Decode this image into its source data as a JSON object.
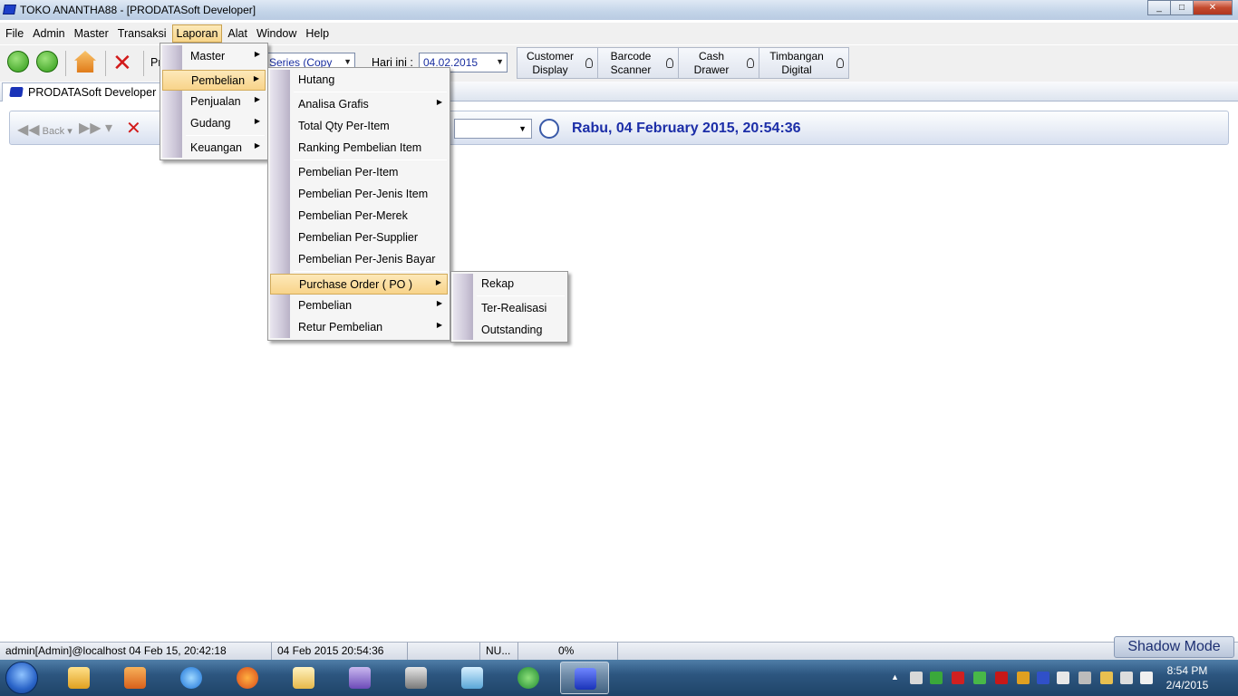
{
  "window": {
    "title": "TOKO ANANTHA88 - [PRODATASoft Developer]",
    "min": "_",
    "max": "□",
    "close": "✕"
  },
  "menubar": [
    "File",
    "Admin",
    "Master",
    "Transaksi",
    "Laporan",
    "Alat",
    "Window",
    "Help"
  ],
  "toolbar": {
    "partial_label": "Pr",
    "series_combo": "Series (Copy",
    "hari_ini_label": "Hari ini :",
    "date_value": "04.02.2015",
    "devices": [
      {
        "line1": "Customer",
        "line2": "Display"
      },
      {
        "line1": "Barcode",
        "line2": "Scanner"
      },
      {
        "line1": "Cash",
        "line2": "Drawer"
      },
      {
        "line1": "Timbangan",
        "line2": "Digital"
      }
    ]
  },
  "tab": {
    "label": "PRODATASoft Developer"
  },
  "navbar": {
    "back_label": "Back",
    "datetime": "Rabu, 04 February 2015, 20:54:36"
  },
  "laporan_menu": [
    "Master",
    "Pembelian",
    "Penjualan",
    "Gudang",
    "Keuangan"
  ],
  "pembelian_menu": {
    "hutang": "Hutang",
    "analisa": "Analisa Grafis",
    "total_qty": "Total Qty Per-Item",
    "ranking": "Ranking Pembelian Item",
    "per_item": "Pembelian Per-Item",
    "per_jenis_item": "Pembelian Per-Jenis Item",
    "per_merek": "Pembelian Per-Merek",
    "per_supplier": "Pembelian Per-Supplier",
    "per_jenis_bayar": "Pembelian Per-Jenis Bayar",
    "purchase_order": "Purchase Order ( PO )",
    "pembelian": "Pembelian",
    "retur": "Retur Pembelian"
  },
  "po_menu": [
    "Rekap",
    "Ter-Realisasi",
    "Outstanding"
  ],
  "statusbar": {
    "user": "admin[Admin]@localhost 04 Feb 15, 20:42:18",
    "datetime": "04 Feb 2015 20:54:36",
    "num": "NU...",
    "progress": "0%",
    "shadow_mode": "Shadow Mode"
  },
  "taskbar": {
    "time": "8:54 PM",
    "date": "2/4/2015"
  },
  "colors": {
    "accent": "#1c2ea8",
    "menu_highlight": "#f8d48a"
  }
}
